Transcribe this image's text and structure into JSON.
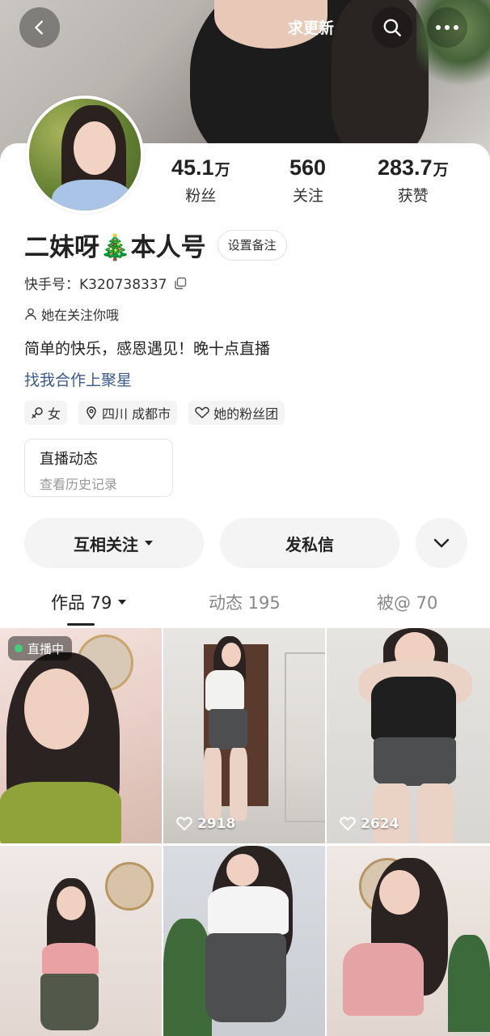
{
  "header": {
    "request_update_label": "求更新",
    "icons": {
      "back": "chevron-left-icon",
      "search": "search-icon",
      "more": "more-dots-icon"
    }
  },
  "profile": {
    "name": "二妹呀🎄本人号",
    "remark_button": "设置备注",
    "kuaishou_id": "快手号：K320738337",
    "follows_you": "她在关注你哦",
    "bio": "简单的快乐，感恩遇见！晚十点直播",
    "collab_link": "找我合作上聚星",
    "stats": [
      {
        "value": "45.1",
        "unit": "万",
        "label": "粉丝"
      },
      {
        "value": "560",
        "unit": "",
        "label": "关注"
      },
      {
        "value": "283.7",
        "unit": "万",
        "label": "获赞"
      }
    ],
    "tags": [
      {
        "icon": "female-icon",
        "label": "女"
      },
      {
        "icon": "location-pin-icon",
        "label": "四川 成都市"
      },
      {
        "icon": "fan-club-icon",
        "label": "她的粉丝团"
      }
    ]
  },
  "live_card": {
    "title": "直播动态",
    "subtitle": "查看历史记录"
  },
  "actions": {
    "follow_label": "互相关注",
    "message_label": "发私信"
  },
  "tabs": [
    {
      "label": "作品 79",
      "active": true
    },
    {
      "label": "动态 195",
      "active": false
    },
    {
      "label": "被@ 70",
      "active": false
    }
  ],
  "videos": [
    {
      "live_badge": "直播中",
      "likes": ""
    },
    {
      "live_badge": "",
      "likes": "2918"
    },
    {
      "live_badge": "",
      "likes": "2624"
    },
    {
      "live_badge": "",
      "likes": ""
    },
    {
      "live_badge": "",
      "likes": ""
    },
    {
      "live_badge": "",
      "likes": ""
    }
  ],
  "colors": {
    "accent_link": "#3a5a8c",
    "live_dot": "#3fd07a",
    "button_bg": "#f4f4f4"
  }
}
